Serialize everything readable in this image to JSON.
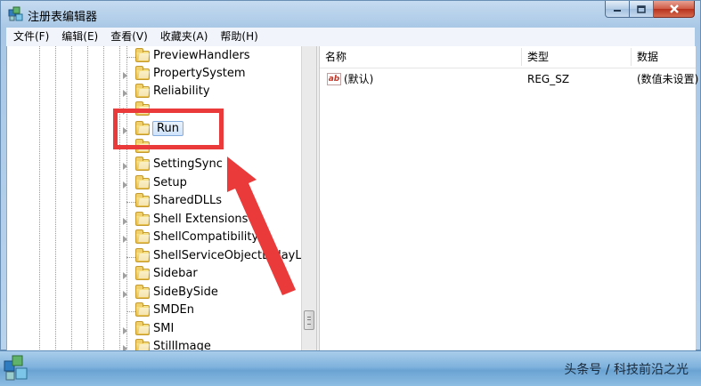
{
  "window": {
    "title": "注册表编辑器",
    "controls": {
      "minimize": "minimize-icon",
      "maximize": "maximize-icon",
      "close": "close-icon"
    }
  },
  "menu": [
    "文件(F)",
    "编辑(E)",
    "查看(V)",
    "收藏夹(A)",
    "帮助(H)"
  ],
  "tree": {
    "items": [
      {
        "label": "PreviewHandlers",
        "expandable": false
      },
      {
        "label": "PropertySystem",
        "expandable": true
      },
      {
        "label": "Reliability",
        "expandable": true
      },
      {
        "label": "Run",
        "expandable": true,
        "selected": true
      },
      {
        "label": "SettingSync",
        "expandable": true
      },
      {
        "label": "Setup",
        "expandable": true
      },
      {
        "label": "SharedDLLs",
        "expandable": false
      },
      {
        "label": "Shell Extensions",
        "expandable": true
      },
      {
        "label": "ShellCompatibility",
        "expandable": true
      },
      {
        "label": "ShellServiceObjectDelayLoa",
        "expandable": false
      },
      {
        "label": "Sidebar",
        "expandable": true
      },
      {
        "label": "SideBySide",
        "expandable": true
      },
      {
        "label": "SMDEn",
        "expandable": false
      },
      {
        "label": "SMI",
        "expandable": true
      },
      {
        "label": "StillImage",
        "expandable": true
      }
    ]
  },
  "values_pane": {
    "columns": [
      "名称",
      "类型",
      "数据"
    ],
    "rows": [
      {
        "name": "(默认)",
        "type": "REG_SZ",
        "data": "(数值未设置)",
        "icon": "ab-string-icon"
      }
    ]
  },
  "taskbar": {
    "watermark": "头条号 / 科技前沿之光"
  },
  "colors": {
    "annotation": "#ea3a3a",
    "title_bar": "#b9d3ec",
    "selection": "#cfe3fb"
  }
}
